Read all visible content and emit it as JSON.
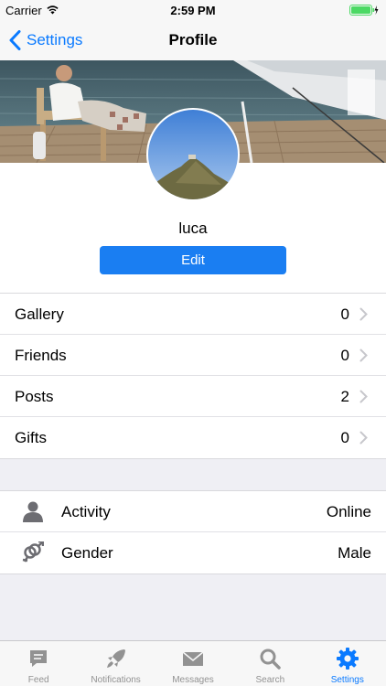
{
  "status_bar": {
    "carrier": "Carrier",
    "time": "2:59 PM",
    "battery_color": "#4cd964"
  },
  "nav": {
    "back_label": "Settings",
    "title": "Profile",
    "accent": "#0a7aff"
  },
  "profile": {
    "username": "luca",
    "edit_label": "Edit",
    "edit_color": "#1a7ef2"
  },
  "stats": [
    {
      "label": "Gallery",
      "value": "0"
    },
    {
      "label": "Friends",
      "value": "0"
    },
    {
      "label": "Posts",
      "value": "2"
    },
    {
      "label": "Gifts",
      "value": "0"
    }
  ],
  "info": [
    {
      "icon": "person-icon",
      "label": "Activity",
      "value": "Online"
    },
    {
      "icon": "gender-icon",
      "label": "Gender",
      "value": "Male"
    }
  ],
  "tabs": [
    {
      "icon": "feed-icon",
      "label": "Feed",
      "active": false
    },
    {
      "icon": "rocket-icon",
      "label": "Notifications",
      "active": false
    },
    {
      "icon": "mail-icon",
      "label": "Messages",
      "active": false
    },
    {
      "icon": "search-icon",
      "label": "Search",
      "active": false
    },
    {
      "icon": "gear-icon",
      "label": "Settings",
      "active": true
    }
  ]
}
